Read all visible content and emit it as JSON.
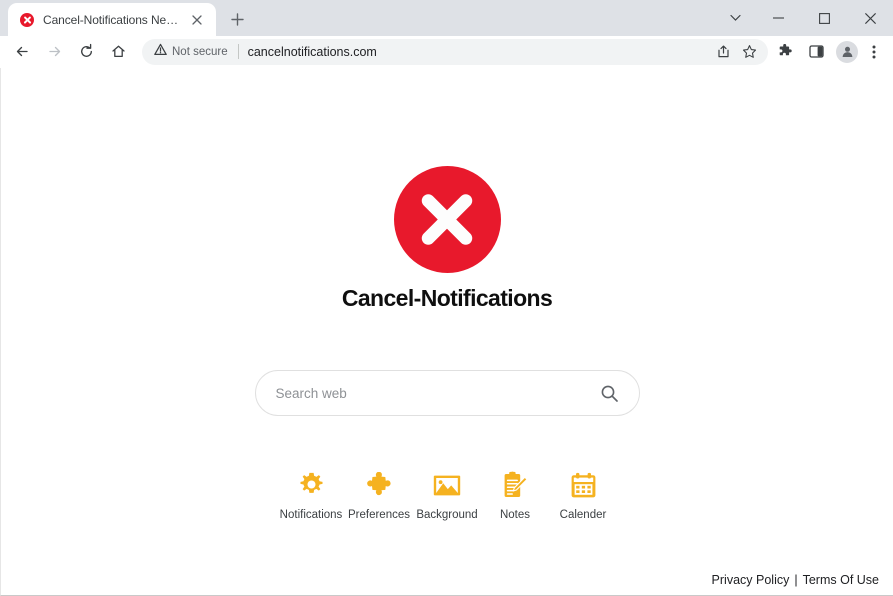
{
  "browser": {
    "tab": {
      "title": "Cancel-Notifications New Tab",
      "favicon_name": "cancel-x-favicon",
      "close_label": "×"
    },
    "new_tab_label": "+",
    "window_controls": [
      {
        "name": "tab-search-button",
        "glyph": "⌄"
      },
      {
        "name": "minimize-button",
        "glyph": "—"
      },
      {
        "name": "maximize-button",
        "glyph": "□"
      },
      {
        "name": "close-window-button",
        "glyph": "✕"
      }
    ],
    "nav": {
      "back_label": "←",
      "forward_label": "→",
      "reload_label": "↻",
      "home_label": "⌂"
    },
    "omnibox": {
      "security_text": "Not secure",
      "security_icon": "warning-triangle-icon",
      "url": "cancelnotifications.com",
      "share_icon": "share-icon",
      "bookmark_icon": "star-icon"
    },
    "toolbar_icons": [
      {
        "name": "extensions-icon",
        "label": "Extensions"
      },
      {
        "name": "side-panel-icon",
        "label": "Side panel"
      },
      {
        "name": "profile-avatar",
        "label": "Profile"
      },
      {
        "name": "three-dot-menu-icon",
        "label": "Customize and control"
      }
    ]
  },
  "page": {
    "logo": {
      "mark_name": "cancel-x-logo",
      "text": "Cancel-Notifications",
      "red": "#e8192c"
    },
    "search": {
      "placeholder": "Search web",
      "value": "",
      "submit_icon": "search-icon"
    },
    "shortcuts": [
      {
        "label": "Notifications",
        "icon": "gear-icon"
      },
      {
        "label": "Preferences",
        "icon": "puzzle-piece-icon"
      },
      {
        "label": "Background",
        "icon": "image-icon"
      },
      {
        "label": "Notes",
        "icon": "notes-clipboard-icon"
      },
      {
        "label": "Calender",
        "icon": "calendar-icon"
      }
    ],
    "shortcut_color": "#f5b220",
    "footer": {
      "privacy_label": "Privacy Policy",
      "divider": "|",
      "terms_label": "Terms Of Use"
    }
  }
}
